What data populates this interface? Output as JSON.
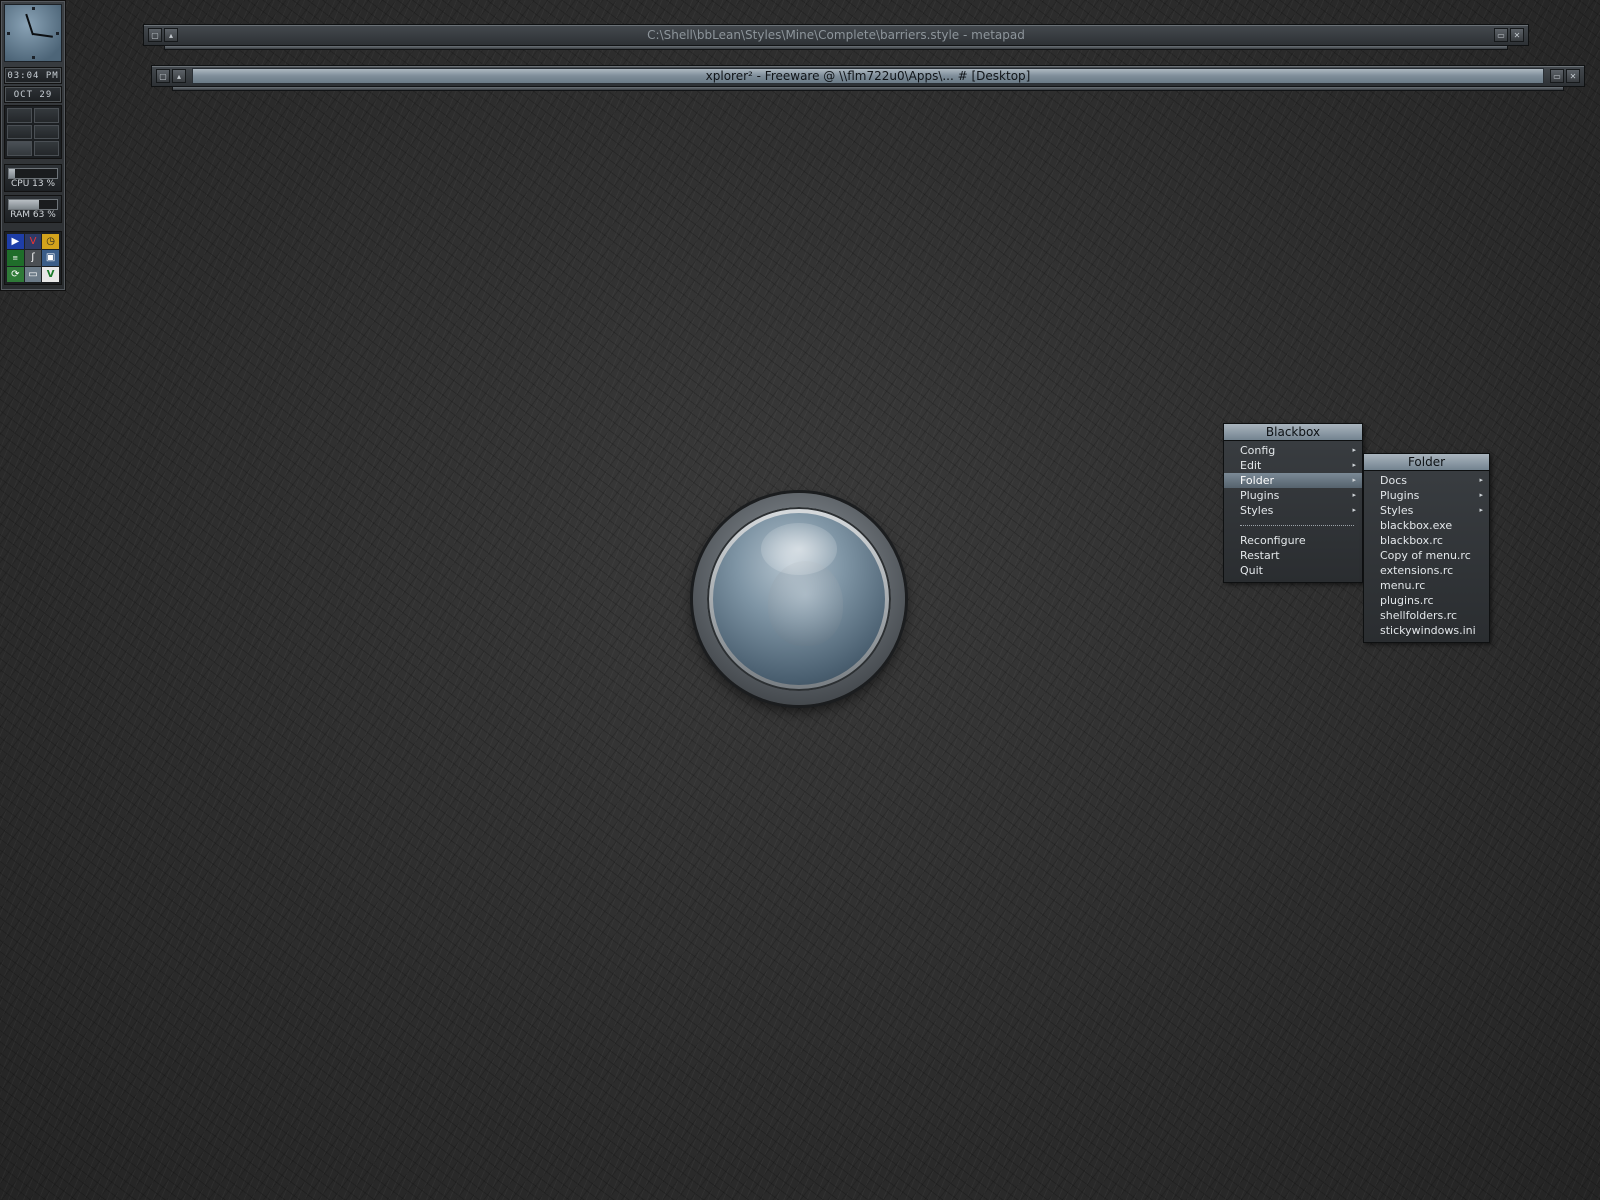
{
  "slit": {
    "time": "03:04 PM",
    "date": "OCT 29",
    "cpu": {
      "label": "CPU 13 %",
      "value": 13
    },
    "ram": {
      "label": "RAM 63 %",
      "value": 63
    },
    "tray_icons": [
      "media-player-icon",
      "antivirus-icon",
      "clock-app-icon",
      "network-meter-icon",
      "tool-icon",
      "network-icon",
      "update-icon",
      "drive-icon",
      "vc-icon"
    ]
  },
  "windows": [
    {
      "title": "C:\\Shell\\bbLean\\Styles\\Mine\\Complete\\barriers.style - metapad",
      "active": false
    },
    {
      "title": "xplorer² - Freeware @ \\\\flm722u0\\Apps\\... # [Desktop]",
      "active": true
    }
  ],
  "root_menu": {
    "title": "Blackbox",
    "items": [
      {
        "label": "Config",
        "submenu": true
      },
      {
        "label": "Edit",
        "submenu": true
      },
      {
        "label": "Folder",
        "submenu": true,
        "selected": true
      },
      {
        "label": "Plugins",
        "submenu": true
      },
      {
        "label": "Styles",
        "submenu": true
      },
      {
        "separator": true
      },
      {
        "label": "Reconfigure"
      },
      {
        "label": "Restart"
      },
      {
        "label": "Quit"
      }
    ]
  },
  "folder_menu": {
    "title": "Folder",
    "items": [
      {
        "label": "Docs",
        "submenu": true
      },
      {
        "label": "Plugins",
        "submenu": true
      },
      {
        "label": "Styles",
        "submenu": true
      },
      {
        "label": "blackbox.exe"
      },
      {
        "label": "blackbox.rc"
      },
      {
        "label": "Copy of menu.rc"
      },
      {
        "label": "extensions.rc"
      },
      {
        "label": "menu.rc"
      },
      {
        "label": "plugins.rc"
      },
      {
        "label": "shellfolders.rc"
      },
      {
        "label": "stickywindows.ini"
      }
    ]
  }
}
